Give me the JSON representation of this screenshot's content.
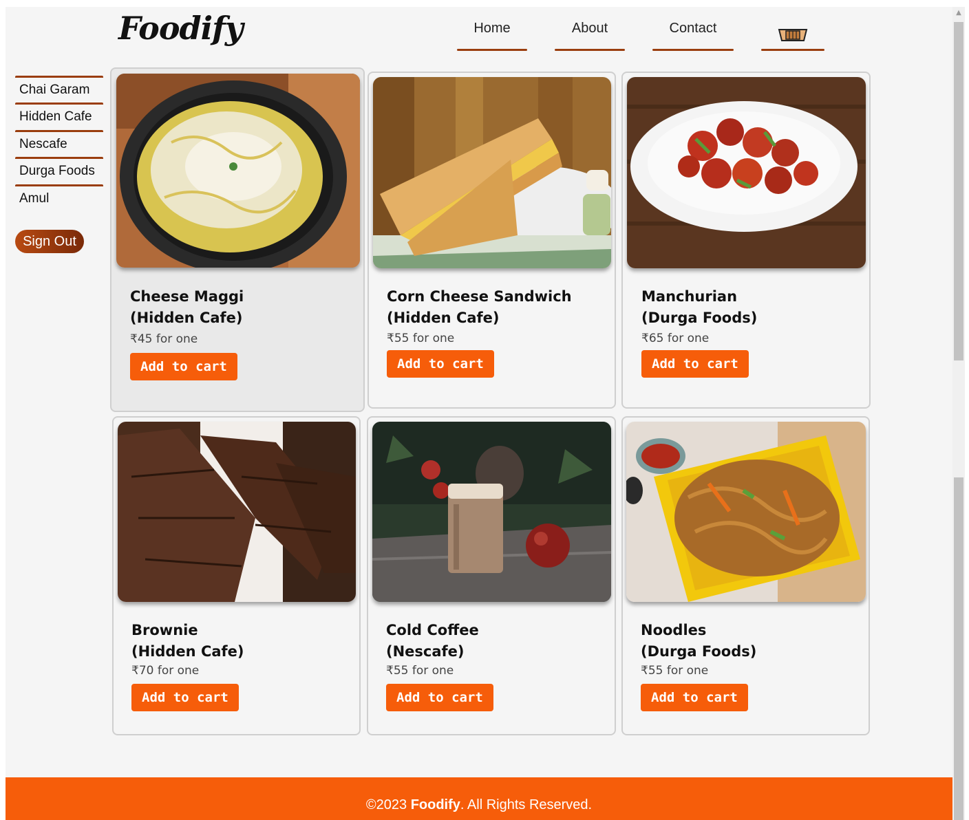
{
  "header": {
    "logo": "Foodify",
    "nav": [
      {
        "label": "Home"
      },
      {
        "label": "About"
      },
      {
        "label": "Contact"
      }
    ],
    "cart_icon": "cart-icon"
  },
  "sidebar": {
    "items": [
      {
        "label": "Chai Garam"
      },
      {
        "label": "Hidden Cafe"
      },
      {
        "label": "Nescafe"
      },
      {
        "label": "Durga Foods"
      },
      {
        "label": "Amul"
      }
    ],
    "signout_label": "Sign Out"
  },
  "products": [
    {
      "title_line1": "Cheese Maggi",
      "title_line2": "(Hidden Cafe)",
      "price": "₹45 for one",
      "button": "Add to cart",
      "image": "cheese-maggi-image"
    },
    {
      "title_line1": "Corn Cheese Sandwich",
      "title_line2": "(Hidden Cafe)",
      "price": "₹55 for one",
      "button": "Add to cart",
      "image": "corn-cheese-sandwich-image"
    },
    {
      "title_line1": "Manchurian",
      "title_line2": "(Durga Foods)",
      "price": "₹65 for one",
      "button": "Add to cart",
      "image": "manchurian-image"
    },
    {
      "title_line1": "Brownie",
      "title_line2": "(Hidden Cafe)",
      "price": "₹70 for one",
      "button": "Add to cart",
      "image": "brownie-image"
    },
    {
      "title_line1": "Cold Coffee",
      "title_line2": "(Nescafe)",
      "price": "₹55 for one",
      "button": "Add to cart",
      "image": "cold-coffee-image"
    },
    {
      "title_line1": "Noodles",
      "title_line2": "(Durga Foods)",
      "price": "₹55 for one",
      "button": "Add to cart",
      "image": "noodles-image"
    }
  ],
  "footer": {
    "prefix": "©2023 ",
    "brand": "Foodify",
    "suffix": ". All Rights Reserved."
  },
  "colors": {
    "accent": "#f65d0a",
    "nav_underline": "#9a3d0e",
    "signout": "#8a320b"
  }
}
